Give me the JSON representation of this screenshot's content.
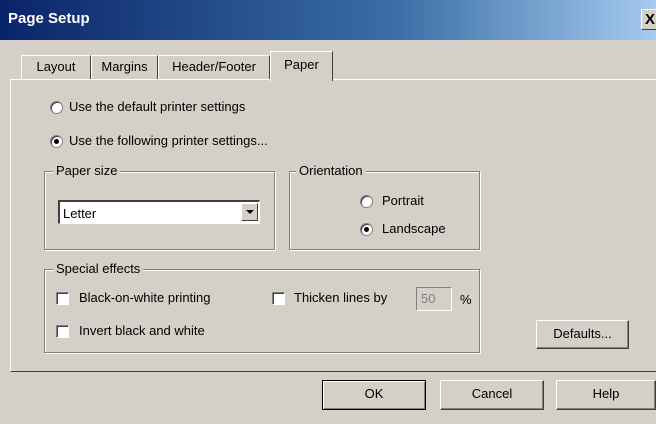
{
  "window": {
    "title": "Page Setup",
    "close_label": "X"
  },
  "tabs": [
    {
      "label": "Layout",
      "active": false
    },
    {
      "label": "Margins",
      "active": false
    },
    {
      "label": "Header/Footer",
      "active": false
    },
    {
      "label": "Paper",
      "active": true
    }
  ],
  "printer_settings": {
    "default_label": "Use the default printer settings",
    "default_selected": false,
    "following_label": "Use the following printer settings...",
    "following_selected": true
  },
  "paper_size": {
    "group_label": "Paper size",
    "selected_value": "Letter"
  },
  "orientation": {
    "group_label": "Orientation",
    "portrait_label": "Portrait",
    "portrait_selected": false,
    "landscape_label": "Landscape",
    "landscape_selected": true
  },
  "special_effects": {
    "group_label": "Special effects",
    "black_on_white_label": "Black-on-white printing",
    "black_on_white_checked": false,
    "invert_label": "Invert black and white",
    "invert_checked": false,
    "thicken_label": "Thicken lines by",
    "thicken_checked": false,
    "thicken_value": "50",
    "thicken_unit": "%"
  },
  "buttons": {
    "defaults": "Defaults...",
    "ok": "OK",
    "cancel": "Cancel",
    "help": "Help"
  }
}
